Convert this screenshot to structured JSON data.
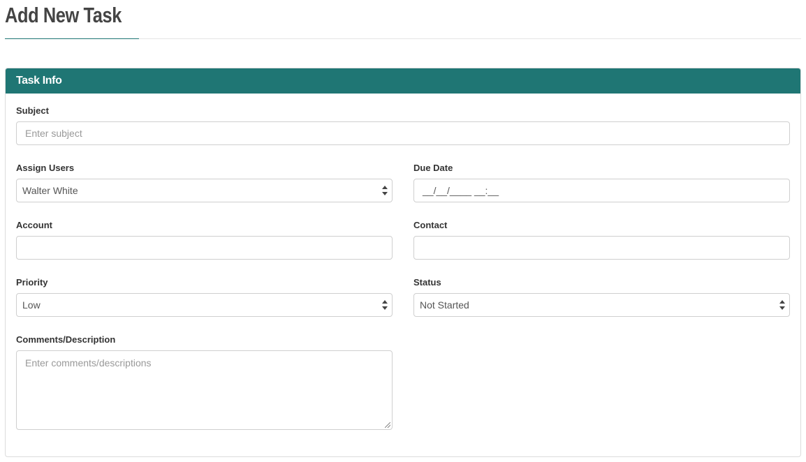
{
  "page": {
    "title": "Add New Task"
  },
  "panel": {
    "heading": "Task Info"
  },
  "form": {
    "subject": {
      "label": "Subject",
      "placeholder": "Enter subject",
      "value": ""
    },
    "assign_users": {
      "label": "Assign Users",
      "value": "Walter White"
    },
    "due_date": {
      "label": "Due Date",
      "value": "__/__/____ __:__"
    },
    "account": {
      "label": "Account",
      "value": ""
    },
    "contact": {
      "label": "Contact",
      "value": ""
    },
    "priority": {
      "label": "Priority",
      "value": "Low"
    },
    "status": {
      "label": "Status",
      "value": "Not Started"
    },
    "comments": {
      "label": "Comments/Description",
      "placeholder": "Enter comments/descriptions",
      "value": ""
    }
  },
  "colors": {
    "accent": "#1f7674",
    "title_text": "#444444",
    "border": "#cfcfcf"
  }
}
